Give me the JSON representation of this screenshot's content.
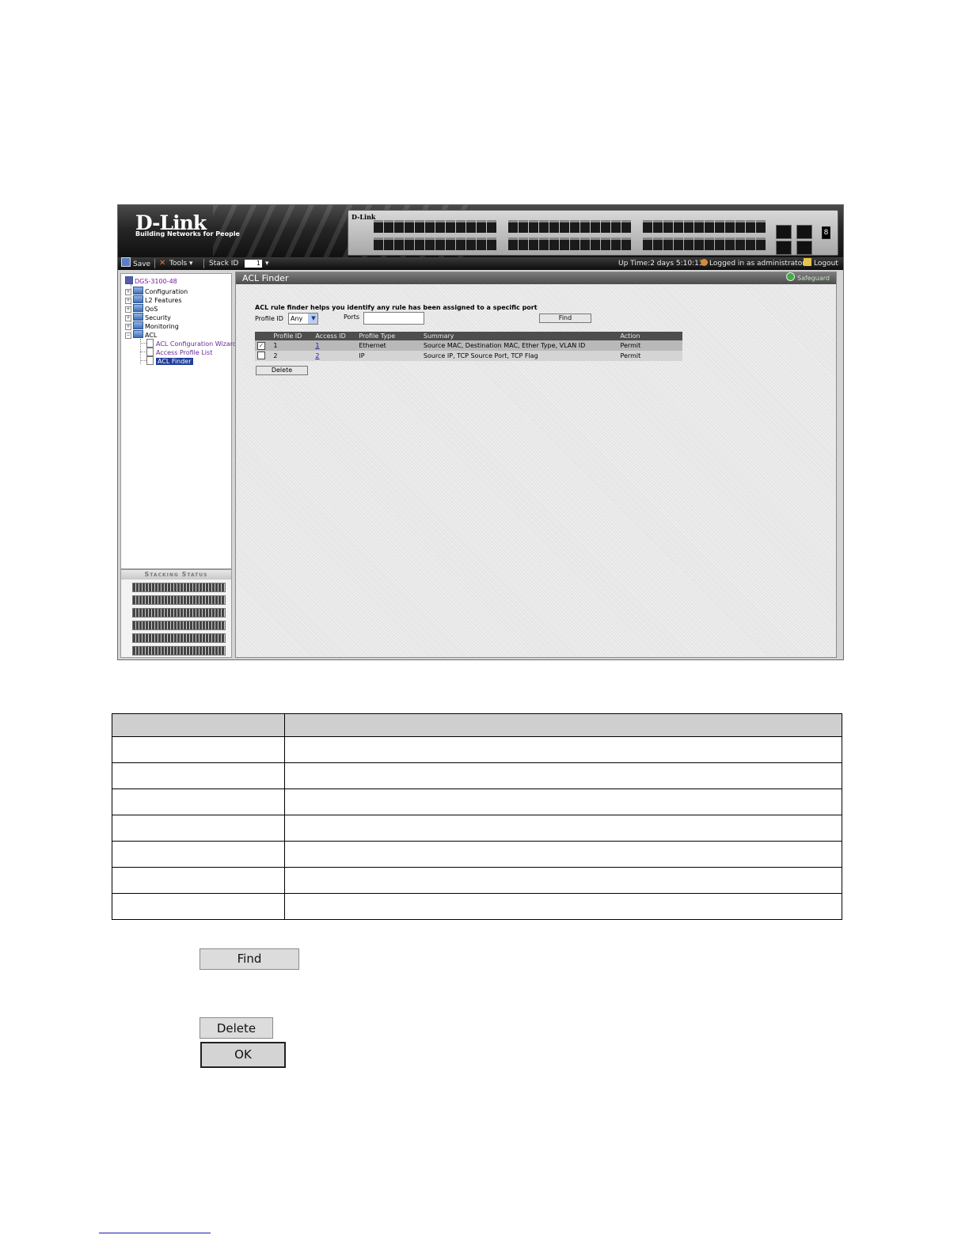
{
  "banner": {
    "logo": "D-Link",
    "tagline": "Building Networks for People",
    "device_brand": "D-Link",
    "seven_seg": "8"
  },
  "toolbar": {
    "save": "Save",
    "tools": "Tools",
    "stack_id_label": "Stack ID",
    "stack_id_value": "1",
    "uptime": "Up Time:2 days 5:10:13",
    "logged_in": "Logged in as administrator",
    "logout": "Logout"
  },
  "tree": {
    "root": "DGS-3100-48",
    "items": [
      "Configuration",
      "L2 Features",
      "QoS",
      "Security",
      "Monitoring",
      "ACL"
    ],
    "acl_children": [
      "ACL Configuration Wizard",
      "Access Profile List",
      "ACL Finder"
    ]
  },
  "stacking": {
    "title": "Stacking Status"
  },
  "main": {
    "title": "ACL Finder",
    "safeguard": "Safeguard",
    "description": "ACL rule finder helps you identify any rule has been assigned to a specific port",
    "profile_label": "Profile ID",
    "profile_value": "Any",
    "ports_label": "Ports",
    "ports_value": "",
    "find_label": "Find",
    "delete_label": "Delete",
    "columns": [
      "Profile ID",
      "Access ID",
      "Profile Type",
      "Summary",
      "Action"
    ],
    "rows": [
      {
        "checked": true,
        "profile_id": "1",
        "access_id": "1",
        "profile_type": "Ethernet",
        "summary": "Source MAC, Destination MAC, Ether Type, VLAN ID",
        "action": "Permit"
      },
      {
        "checked": false,
        "profile_id": "2",
        "access_id": "2",
        "profile_type": "IP",
        "summary": "Source IP, TCP Source Port, TCP Flag",
        "action": "Permit"
      }
    ]
  },
  "doc_buttons": {
    "find": "Find",
    "delete": "Delete",
    "ok": "OK"
  }
}
